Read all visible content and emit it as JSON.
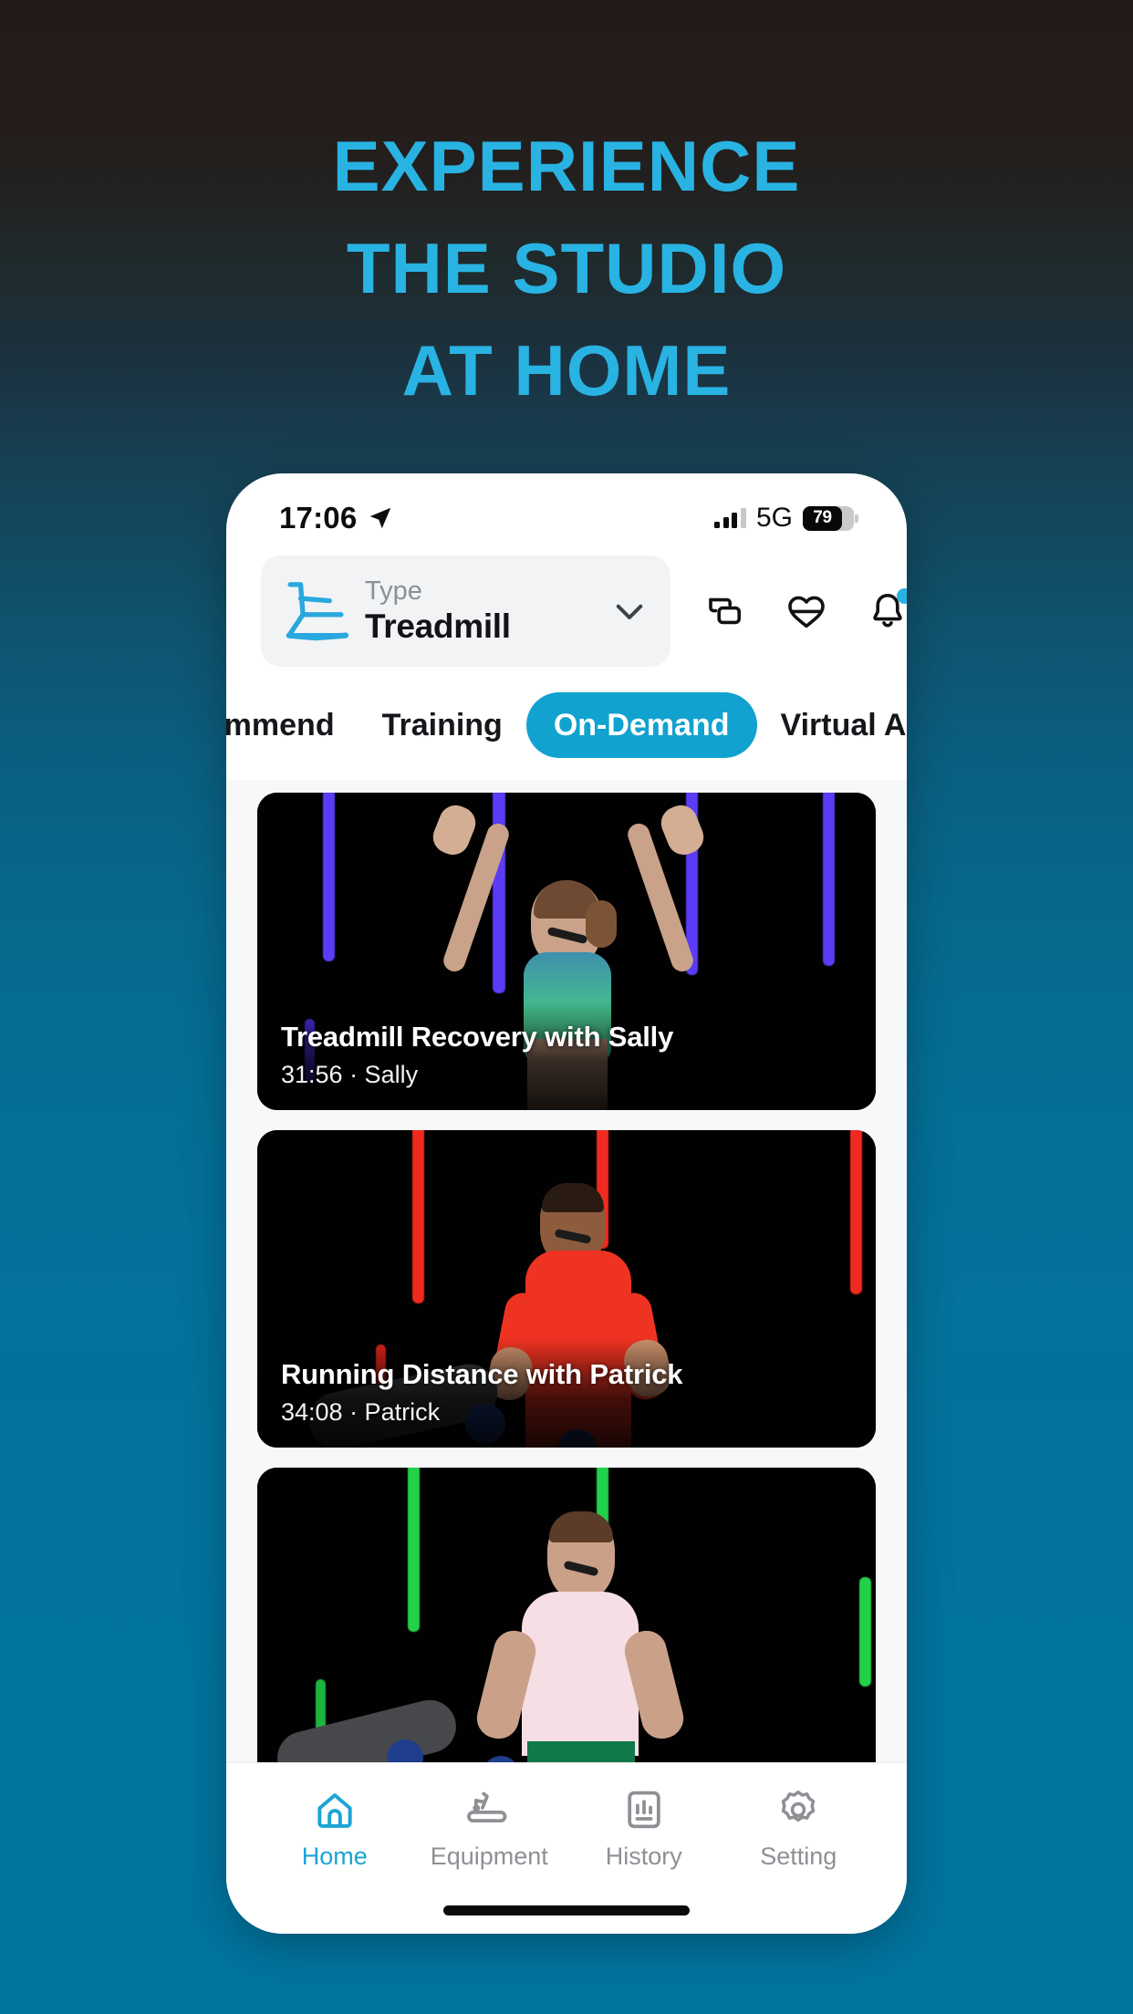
{
  "promo": {
    "headline_lines": [
      "EXPERIENCE",
      "THE STUDIO",
      "AT HOME"
    ],
    "headline_color": "#29b3e3",
    "background_top_color": "#241b19",
    "background_bottom_color": "#01749f"
  },
  "statusbar": {
    "time": "17:06",
    "location_icon": "location-arrow-icon",
    "network": "5G",
    "battery_percent": "79",
    "signal_icon": "cellular-signal-icon"
  },
  "header": {
    "type_selector": {
      "label": "Type",
      "value": "Treadmill",
      "icon": "treadmill-icon",
      "chevron": "chevron-down-icon"
    },
    "icons": [
      {
        "name": "cast-screen-icon",
        "badge": false
      },
      {
        "name": "heart-rate-icon",
        "badge": false
      },
      {
        "name": "notification-bell-icon",
        "badge": true,
        "badge_color": "#29b3e3"
      }
    ]
  },
  "tabs": {
    "active_color": "#11a2cf",
    "items": [
      {
        "label": "commend",
        "active": false
      },
      {
        "label": "Training",
        "active": false
      },
      {
        "label": "On-Demand",
        "active": true
      },
      {
        "label": "Virtual Active",
        "active": false
      }
    ]
  },
  "classes": [
    {
      "title": "Treadmill Recovery  with Sally",
      "duration": "31:56",
      "instructor": "Sally",
      "subtitle": "31:56 · Sally",
      "neon_color": "#5b3bf5",
      "top_color": "#46c48c",
      "bottom_color": "#1f2f7a"
    },
    {
      "title": "Running Distance with Patrick",
      "duration": "34:08",
      "instructor": "Patrick",
      "subtitle": "34:08 · Patrick",
      "neon_color": "#f02a20",
      "top_color": "#ef3322",
      "bottom_color": "#cfc6bb"
    },
    {
      "title": "",
      "duration": "",
      "instructor": "",
      "subtitle": "",
      "neon_color": "#22d14a",
      "top_color": "#f6dfe4",
      "bottom_color": "#12794a"
    }
  ],
  "bottom_nav": {
    "active_color": "#1ba4d4",
    "items": [
      {
        "label": "Home",
        "icon": "home-icon",
        "active": true
      },
      {
        "label": "Equipment",
        "icon": "treadmill-equipment-icon",
        "active": false
      },
      {
        "label": "History",
        "icon": "history-chart-icon",
        "active": false
      },
      {
        "label": "Setting",
        "icon": "gear-icon",
        "active": false
      }
    ]
  }
}
